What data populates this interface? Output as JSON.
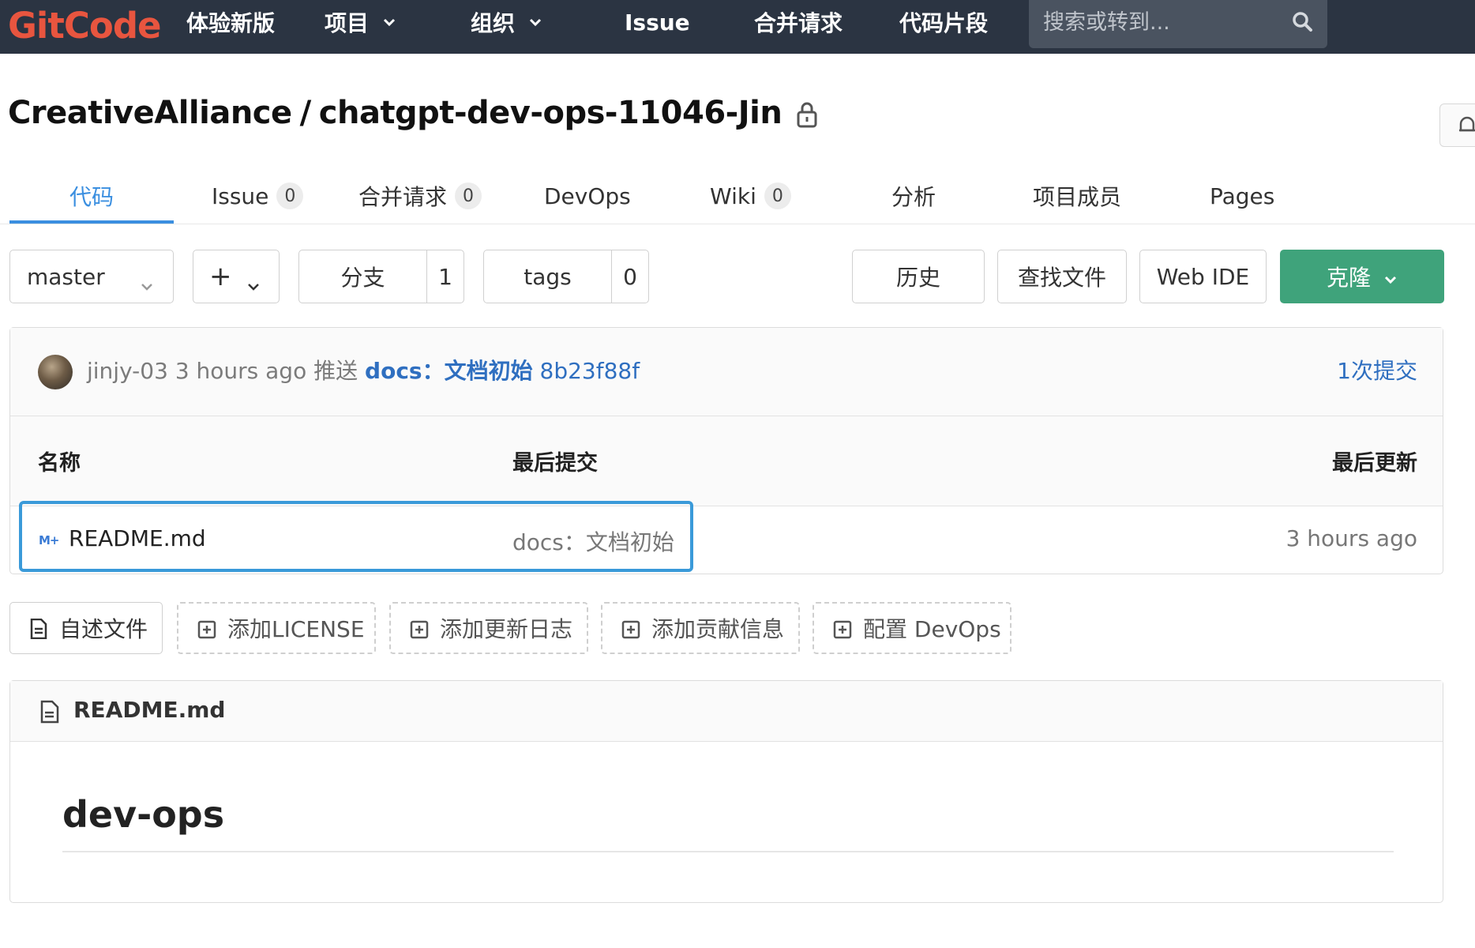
{
  "brand": {
    "logo": "GitCode",
    "logo_color": "#e8553f"
  },
  "topnav": {
    "items": [
      {
        "label": "体验新版"
      },
      {
        "label": "项目",
        "dropdown": true
      },
      {
        "label": "组织",
        "dropdown": true
      },
      {
        "label": "Issue"
      },
      {
        "label": "合并请求"
      },
      {
        "label": "代码片段"
      }
    ],
    "search_placeholder": "搜索或转到..."
  },
  "repo": {
    "namespace": "CreativeAlliance",
    "separator": "/",
    "name": "chatgpt-dev-ops-11046-Jin",
    "private": true
  },
  "tabs": [
    {
      "label": "代码",
      "active": true
    },
    {
      "label": "Issue",
      "count": "0"
    },
    {
      "label": "合并请求",
      "count": "0"
    },
    {
      "label": "DevOps"
    },
    {
      "label": "Wiki",
      "count": "0"
    },
    {
      "label": "分析"
    },
    {
      "label": "项目成员"
    },
    {
      "label": "Pages"
    }
  ],
  "toolbar": {
    "branch": "master",
    "add_symbol": "+",
    "branches_label": "分支",
    "branches_count": "1",
    "tags_label": "tags",
    "tags_count": "0",
    "history": "历史",
    "find_file": "查找文件",
    "web_ide": "Web IDE",
    "clone": "克隆",
    "clone_color": "#3fa37b"
  },
  "commit": {
    "author": "jinjy-03",
    "time": "3 hours ago",
    "action": "推送",
    "message": "docs：文档初始",
    "sha": "8b23f88f",
    "count_label": "1次提交"
  },
  "file_table": {
    "headers": {
      "name": "名称",
      "last_commit": "最后提交",
      "last_update": "最后更新"
    },
    "rows": [
      {
        "icon": "M+",
        "name": "README.md",
        "commit": "docs：文档初始",
        "updated": "3 hours ago"
      }
    ],
    "highlight_color": "#3a9ad9"
  },
  "actions": [
    {
      "label": "自述文件",
      "style": "solid"
    },
    {
      "label": "添加LICENSE",
      "style": "dashed"
    },
    {
      "label": "添加更新日志",
      "style": "dashed"
    },
    {
      "label": "添加贡献信息",
      "style": "dashed"
    },
    {
      "label": "配置 DevOps",
      "style": "dashed"
    }
  ],
  "readme": {
    "file": "README.md",
    "heading": "dev-ops"
  }
}
